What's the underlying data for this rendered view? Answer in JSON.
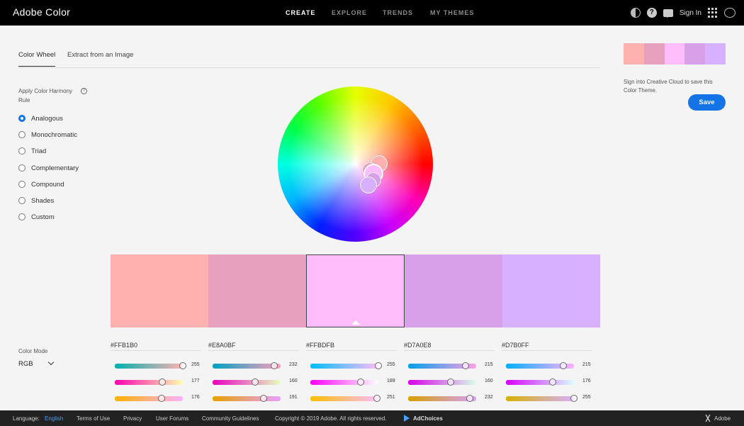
{
  "app": {
    "title": "Adobe Color"
  },
  "nav": {
    "items": [
      "CREATE",
      "EXPLORE",
      "TRENDS",
      "MY THEMES"
    ],
    "active": "CREATE"
  },
  "header_right": {
    "sign_in": "Sign In",
    "icons": [
      "theme-toggle-icon",
      "help-icon",
      "feedback-icon",
      "app-grid-icon",
      "creative-cloud-icon"
    ]
  },
  "tabs": [
    {
      "label": "Color Wheel",
      "active": true
    },
    {
      "label": "Extract from an Image",
      "active": false
    }
  ],
  "harmony": {
    "label": "Apply Color Harmony Rule",
    "info": "?",
    "rules": [
      "Analogous",
      "Monochromatic",
      "Triad",
      "Complementary",
      "Compound",
      "Shades",
      "Custom"
    ],
    "selected": "Analogous"
  },
  "swatches": [
    {
      "hex": "#FFB1B0",
      "color": "#ffb1b0",
      "channels": [
        255,
        177,
        176
      ],
      "selected": false
    },
    {
      "hex": "#E8A0BF",
      "color": "#e8a0bf",
      "channels": [
        232,
        160,
        191
      ],
      "selected": false
    },
    {
      "hex": "#FFBDFB",
      "color": "#ffbdfb",
      "channels": [
        255,
        189,
        251
      ],
      "selected": true
    },
    {
      "hex": "#D7A0E8",
      "color": "#d7a0e8",
      "channels": [
        215,
        160,
        232
      ],
      "selected": false
    },
    {
      "hex": "#D7B0FF",
      "color": "#d7b0ff",
      "channels": [
        215,
        176,
        255
      ],
      "selected": false
    }
  ],
  "color_mode": {
    "label": "Color Mode",
    "value": "RGB"
  },
  "panel": {
    "message": "Sign into Creative Cloud to save this Color Theme.",
    "save_label": "Save"
  },
  "footer": {
    "language_label": "Language:",
    "language_value": "English",
    "links": [
      "Terms of Use",
      "Privacy",
      "User Forums",
      "Community Guidelines"
    ],
    "copyright": "Copyright © 2019 Adobe. All rights reserved.",
    "adchoices": "AdChoices",
    "brand": "Adobe"
  },
  "colors": {
    "accent": "#1473e6",
    "topbar": "#000000",
    "footer": "#222222",
    "background": "#f4f4f4"
  }
}
